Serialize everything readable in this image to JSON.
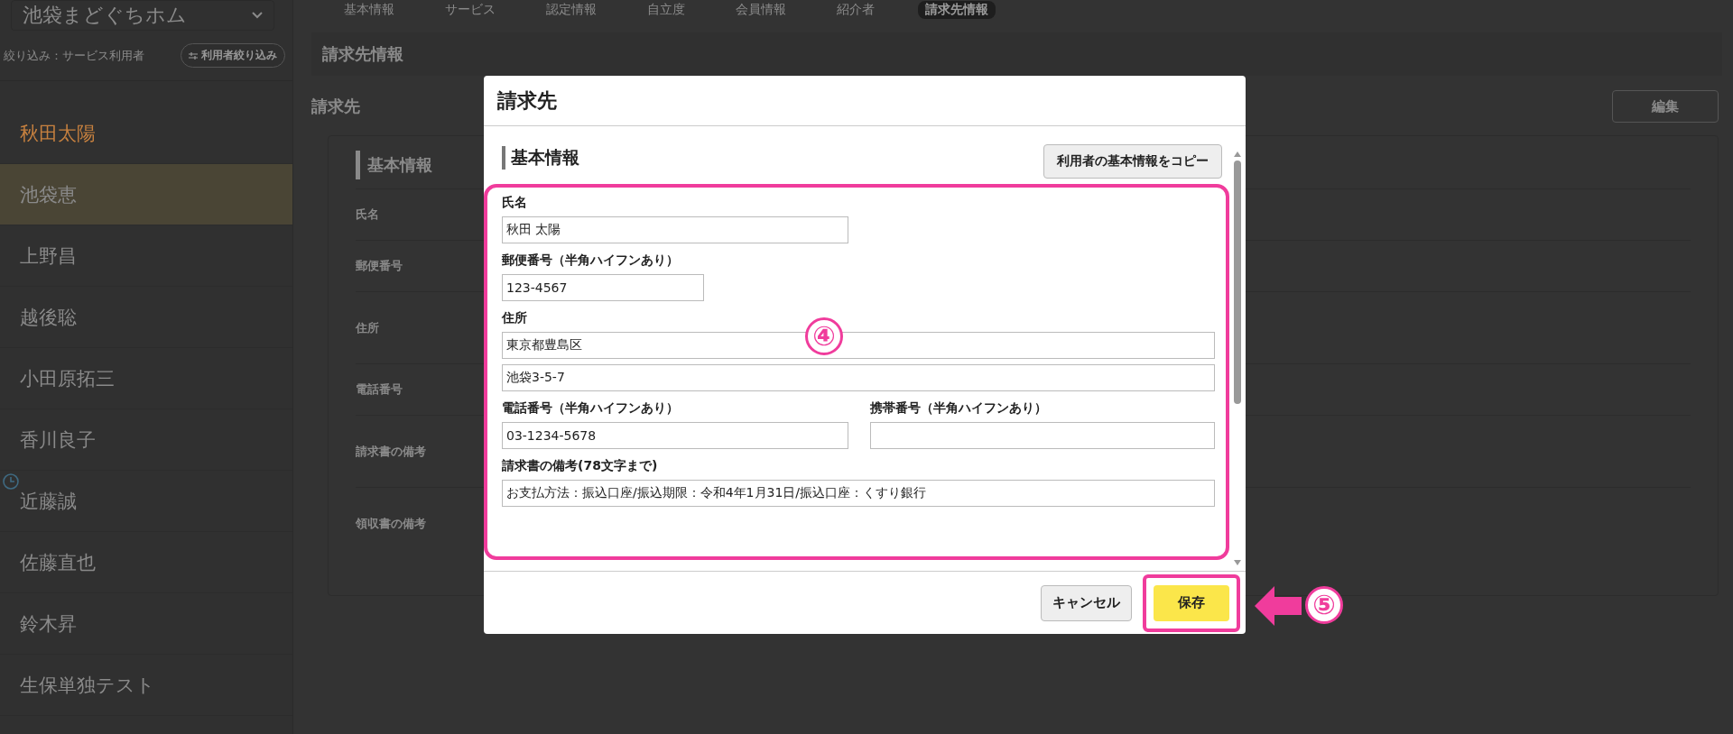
{
  "sidebar": {
    "facility_select": "池袋まどぐちホム",
    "filter_label": "絞り込み：サービス利用者",
    "filter_button": "利用者絞り込み",
    "users": [
      {
        "name": "秋田太陽",
        "selected": true,
        "highlighted": false,
        "clock": false
      },
      {
        "name": "池袋恵",
        "selected": false,
        "highlighted": true,
        "clock": false
      },
      {
        "name": "上野昌",
        "selected": false,
        "highlighted": false,
        "clock": false
      },
      {
        "name": "越後聡",
        "selected": false,
        "highlighted": false,
        "clock": false
      },
      {
        "name": "小田原拓三",
        "selected": false,
        "highlighted": false,
        "clock": false
      },
      {
        "name": "香川良子",
        "selected": false,
        "highlighted": false,
        "clock": false
      },
      {
        "name": "近藤誠",
        "selected": false,
        "highlighted": false,
        "clock": true
      },
      {
        "name": "佐藤直也",
        "selected": false,
        "highlighted": false,
        "clock": false
      },
      {
        "name": "鈴木昇",
        "selected": false,
        "highlighted": false,
        "clock": false
      },
      {
        "name": "生保単独テスト",
        "selected": false,
        "highlighted": false,
        "clock": false
      }
    ]
  },
  "tabs": [
    {
      "label": "基本情報",
      "selected": false
    },
    {
      "label": "サービス",
      "selected": false
    },
    {
      "label": "認定情報",
      "selected": false
    },
    {
      "label": "自立度",
      "selected": false
    },
    {
      "label": "会員情報",
      "selected": false
    },
    {
      "label": "紹介者",
      "selected": false
    },
    {
      "label": "請求先情報",
      "selected": true
    }
  ],
  "page": {
    "section_title": "請求先情報",
    "heading": "請求先",
    "edit_button": "編集",
    "card": {
      "title": "基本情報",
      "rows": [
        {
          "label": "氏名",
          "kind": "short"
        },
        {
          "label": "郵便番号",
          "kind": "short"
        },
        {
          "label": "住所",
          "kind": "tall"
        },
        {
          "label": "電話番号",
          "kind": "short"
        },
        {
          "label": "請求書の備考",
          "kind": "tall"
        },
        {
          "label": "領収書の備考",
          "kind": "tall"
        }
      ]
    }
  },
  "dialog": {
    "title": "請求先",
    "section_title": "基本情報",
    "copy_button": "利用者の基本情報をコピー",
    "fields": [
      {
        "kind": "name",
        "label": "氏名",
        "value": "秋田 太陽"
      },
      {
        "kind": "postal",
        "label": "郵便番号（半角ハイフンあり）",
        "value": "123-4567"
      },
      {
        "kind": "address",
        "label": "住所",
        "values": [
          "東京都豊島区",
          "池袋3-5-7"
        ]
      },
      {
        "kind": "pair",
        "items": [
          {
            "label": "電話番号（半角ハイフンあり）",
            "value": "03-1234-5678"
          },
          {
            "label": "携帯番号（半角ハイフンあり）"
          }
        ]
      },
      {
        "kind": "note",
        "label": "請求書の備考(78文字まで)",
        "value": "お支払方法：振込口座/振込期限：令和4年1月31日/振込口座：くすり銀行"
      }
    ],
    "cancel_button": "キャンセル",
    "save_button": "保存"
  },
  "annotations": {
    "fields_marker": "④",
    "save_marker": "⑤"
  }
}
